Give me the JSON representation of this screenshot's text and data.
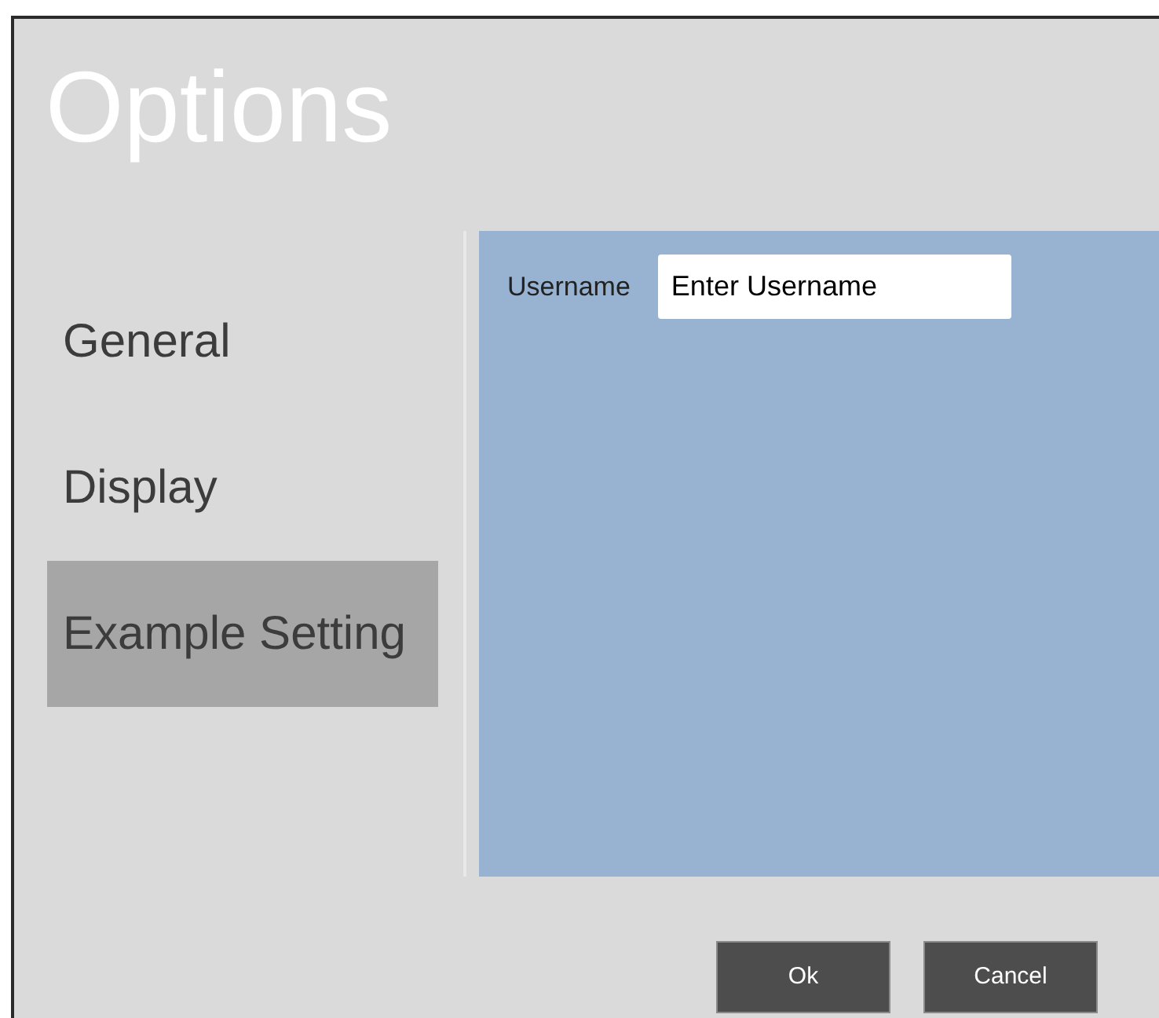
{
  "window": {
    "title": "Options"
  },
  "sidebar": {
    "items": [
      {
        "label": "General",
        "selected": false
      },
      {
        "label": "Display",
        "selected": false
      },
      {
        "label": "Example Setting",
        "selected": true
      }
    ]
  },
  "panel": {
    "fields": [
      {
        "label": "Username",
        "value": "Enter Username"
      }
    ]
  },
  "buttons": [
    "Ok",
    "Cancel"
  ]
}
